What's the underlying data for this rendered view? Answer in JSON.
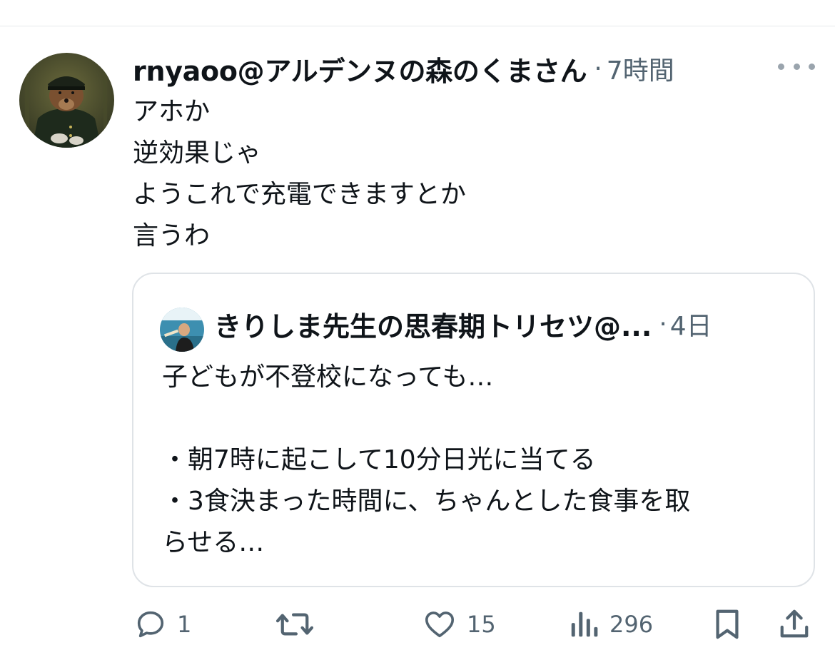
{
  "tweet": {
    "display_name": "rnyaoo@アルデンヌの森のくまさん",
    "separator": "·",
    "time": "7時間",
    "lines": [
      "アホか",
      "逆効果じゃ",
      "ようこれで充電できますとか",
      "言うわ"
    ]
  },
  "quote": {
    "display_name": "きりしま先生の思春期トリセツ@...",
    "separator": "·",
    "time": "4日",
    "lines": [
      "子どもが不登校になっても…",
      "",
      "・朝7時に起こして10分日光に当てる",
      "・3食決まった時間に、ちゃんとした食事を取",
      "らせる…"
    ]
  },
  "actions": {
    "replies": "1",
    "retweets": "",
    "likes": "15",
    "views": "296"
  },
  "icons": {
    "more": "more-horizontal-icon",
    "reply": "reply-icon",
    "retweet": "retweet-icon",
    "like": "heart-icon",
    "views": "views-chart-icon",
    "bookmark": "bookmark-icon",
    "share": "share-icon"
  },
  "colors": {
    "text": "#0f1419",
    "secondary": "#536471",
    "border": "#dfe3e7"
  }
}
